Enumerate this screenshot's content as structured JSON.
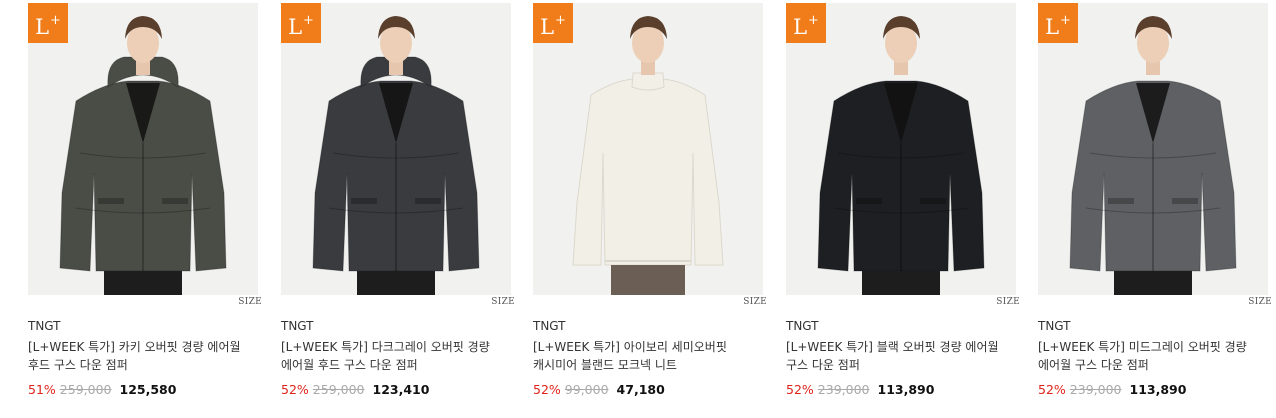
{
  "products": [
    {
      "badge": "L",
      "badge_sup": "+",
      "size_label": "SIZE",
      "brand": "TNGT",
      "title": "[L+WEEK 특가] 카키 오버핏 경량 에어월 후드 구스 다운 점퍼",
      "discount": "51%",
      "original_price": "259,000",
      "sale_price": "125,580",
      "item_color": "#4a4d46",
      "item_type": "hooded-down-jacket"
    },
    {
      "badge": "L",
      "badge_sup": "+",
      "size_label": "SIZE",
      "brand": "TNGT",
      "title": "[L+WEEK 특가] 다크그레이 오버핏 경량 에어월 후드 구스 다운 점퍼",
      "discount": "52%",
      "original_price": "259,000",
      "sale_price": "123,410",
      "item_color": "#3a3b3f",
      "item_type": "hooded-down-jacket"
    },
    {
      "badge": "L",
      "badge_sup": "+",
      "size_label": "SIZE",
      "brand": "TNGT",
      "title": "[L+WEEK 특가] 아이보리 세미오버핏 캐시미어 블랜드 모크넥 니트",
      "discount": "52%",
      "original_price": "99,000",
      "sale_price": "47,180",
      "item_color": "#f2efe6",
      "item_type": "mockneck-knit"
    },
    {
      "badge": "L",
      "badge_sup": "+",
      "size_label": "SIZE",
      "brand": "TNGT",
      "title": "[L+WEEK 특가] 블랙 오버핏 경량 에어월 구스 다운 점퍼",
      "discount": "52%",
      "original_price": "239,000",
      "sale_price": "113,890",
      "item_color": "#1e1f22",
      "item_type": "down-jacket"
    },
    {
      "badge": "L",
      "badge_sup": "+",
      "size_label": "SIZE",
      "brand": "TNGT",
      "title": "[L+WEEK 특가] 미드그레이 오버핏 경량 에어월 구스 다운 점퍼",
      "discount": "52%",
      "original_price": "239,000",
      "sale_price": "113,890",
      "item_color": "#5e6063",
      "item_type": "down-jacket"
    }
  ],
  "colors": {
    "badge_bg": "#f07d1a",
    "discount": "#e0231b",
    "original_price": "#aaaaaa",
    "photo_bg": "#f1f1f0"
  }
}
